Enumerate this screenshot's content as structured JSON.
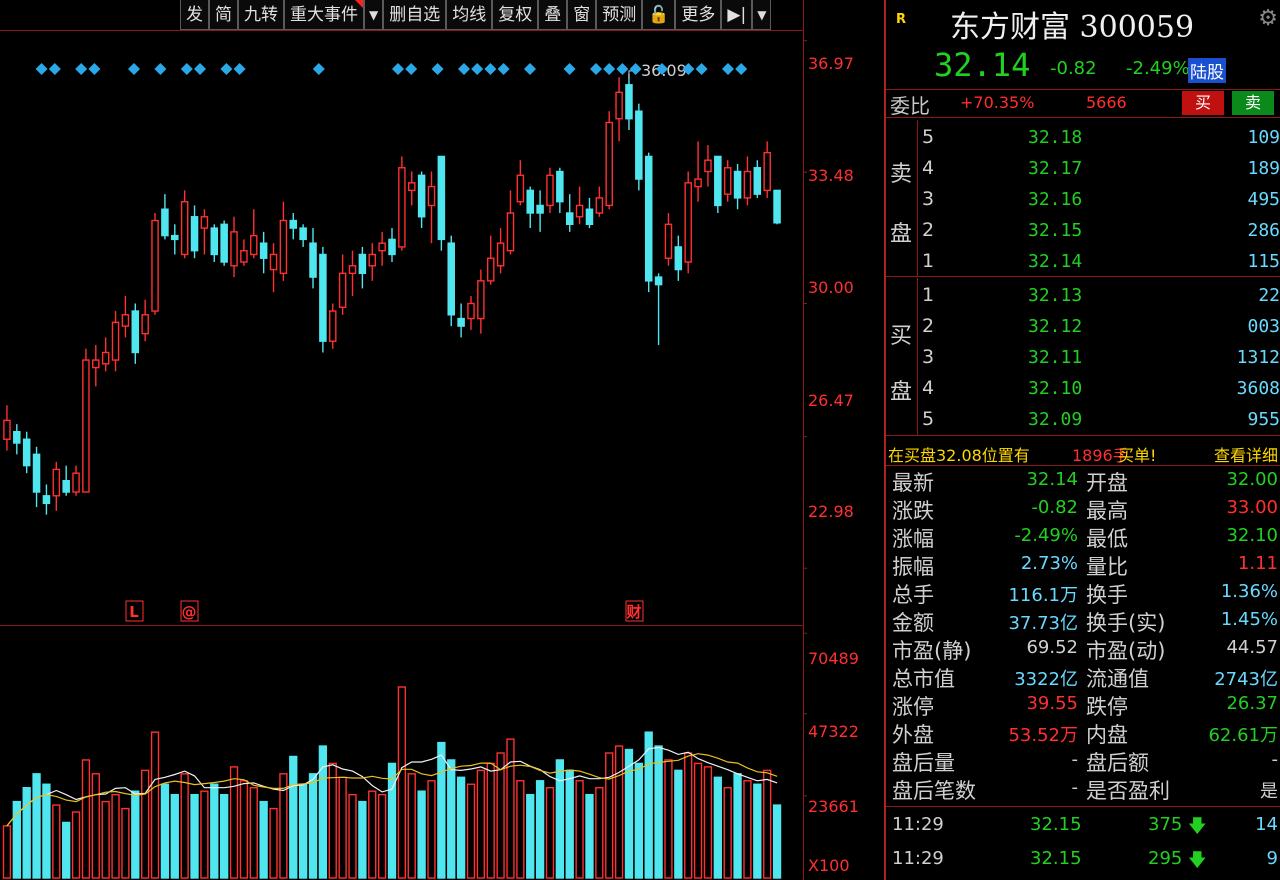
{
  "toolbar": [
    "发",
    "简",
    "九转",
    "重大事件",
    "▼",
    "删自选",
    "均线",
    "复权",
    "叠",
    "窗",
    "预测",
    "🔓",
    "更多",
    "▶|",
    "▼"
  ],
  "header": {
    "badge": "R",
    "title": "东方财富 300059",
    "price": "32.14",
    "change": "-0.82",
    "change_pct": "-2.49%",
    "tag": "陆股"
  },
  "order_ratio": {
    "label": "委比",
    "ratio": "+70.35%",
    "diff": "5666",
    "buy_label": "买",
    "sell_label": "卖"
  },
  "ask_book": {
    "side_labels": [
      "卖",
      "盘"
    ],
    "levels": [
      {
        "n": "5",
        "price": "32.18",
        "vol": "109"
      },
      {
        "n": "4",
        "price": "32.17",
        "vol": "189"
      },
      {
        "n": "3",
        "price": "32.16",
        "vol": "495"
      },
      {
        "n": "2",
        "price": "32.15",
        "vol": "286"
      },
      {
        "n": "1",
        "price": "32.14",
        "vol": "115"
      }
    ]
  },
  "bid_book": {
    "side_labels": [
      "买",
      "盘"
    ],
    "levels": [
      {
        "n": "1",
        "price": "32.13",
        "vol": "22"
      },
      {
        "n": "2",
        "price": "32.12",
        "vol": "003"
      },
      {
        "n": "3",
        "price": "32.11",
        "vol": "1312"
      },
      {
        "n": "4",
        "price": "32.10",
        "vol": "3608"
      },
      {
        "n": "5",
        "price": "32.09",
        "vol": "955"
      }
    ]
  },
  "notice": {
    "text_a": "在买盘32.08位置有",
    "qty": "1896手",
    "text_c": "买单!",
    "link": "查看详细"
  },
  "stats": [
    {
      "l1": "最新",
      "v1": "32.14",
      "c1": "#22d022",
      "l2": "开盘",
      "v2": "32.00",
      "c2": "#22d022"
    },
    {
      "l1": "涨跌",
      "v1": "-0.82",
      "c1": "#22d022",
      "l2": "最高",
      "v2": "33.00",
      "c2": "#ff3030"
    },
    {
      "l1": "涨幅",
      "v1": "-2.49%",
      "c1": "#22d022",
      "l2": "最低",
      "v2": "32.10",
      "c2": "#22d022"
    },
    {
      "l1": "振幅",
      "v1": "2.73%",
      "c1": "#6ad9ff",
      "l2": "量比",
      "v2": "1.11",
      "c2": "#ff3030"
    },
    {
      "l1": "总手",
      "v1": "116.1万",
      "c1": "#6ad9ff",
      "l2": "换手",
      "v2": "1.36%",
      "c2": "#6ad9ff"
    },
    {
      "l1": "金额",
      "v1": "37.73亿",
      "c1": "#6ad9ff",
      "l2": "换手(实)",
      "v2": "1.45%",
      "c2": "#6ad9ff"
    },
    {
      "l1": "市盈(静)",
      "v1": "69.52",
      "c1": "#d0d0d0",
      "l2": "市盈(动)",
      "v2": "44.57",
      "c2": "#d0d0d0"
    },
    {
      "l1": "总市值",
      "v1": "3322亿",
      "c1": "#6ad9ff",
      "l2": "流通值",
      "v2": "2743亿",
      "c2": "#6ad9ff"
    },
    {
      "l1": "涨停",
      "v1": "39.55",
      "c1": "#ff3030",
      "l2": "跌停",
      "v2": "26.37",
      "c2": "#22d022"
    },
    {
      "l1": "外盘",
      "v1": "53.52万",
      "c1": "#ff3030",
      "l2": "内盘",
      "v2": "62.61万",
      "c2": "#22d022"
    },
    {
      "l1": "盘后量",
      "v1": "-",
      "c1": "#d0d0d0",
      "l2": "盘后额",
      "v2": "-",
      "c2": "#d0d0d0"
    },
    {
      "l1": "盘后笔数",
      "v1": "-",
      "c1": "#d0d0d0",
      "l2": "是否盈利",
      "v2": "是",
      "c2": "#d0d0d0"
    }
  ],
  "ticks": [
    {
      "time": "11:29",
      "price": "32.15",
      "vol": "375",
      "count": "14"
    },
    {
      "time": "11:29",
      "price": "32.15",
      "vol": "295",
      "count": "9"
    }
  ],
  "chart_data": {
    "type": "candlestick",
    "price_axis": [
      "36.97",
      "33.48",
      "30.00",
      "26.47",
      "22.98"
    ],
    "ylim": [
      21.5,
      37.2
    ],
    "max_label": "36.09",
    "markers": [
      "L",
      "@",
      "财"
    ],
    "volume_axis": [
      "70489",
      "47322",
      "23661",
      "X100"
    ],
    "volume_ylim": [
      0,
      72000
    ],
    "candles": [
      {
        "o": 26.4,
        "c": 26.9,
        "h": 27.3,
        "l": 26.1
      },
      {
        "o": 26.6,
        "c": 26.3,
        "h": 26.8,
        "l": 26.0
      },
      {
        "o": 26.4,
        "c": 25.7,
        "h": 26.6,
        "l": 25.5
      },
      {
        "o": 26.0,
        "c": 25.0,
        "h": 26.2,
        "l": 24.6
      },
      {
        "o": 24.9,
        "c": 24.7,
        "h": 25.2,
        "l": 24.4
      },
      {
        "o": 24.9,
        "c": 25.6,
        "h": 25.8,
        "l": 24.5
      },
      {
        "o": 25.3,
        "c": 25.0,
        "h": 25.7,
        "l": 24.9
      },
      {
        "o": 25.0,
        "c": 25.5,
        "h": 25.7,
        "l": 24.9
      },
      {
        "o": 25.0,
        "c": 28.5,
        "h": 28.8,
        "l": 25.0
      },
      {
        "o": 28.3,
        "c": 28.5,
        "h": 28.9,
        "l": 27.8
      },
      {
        "o": 28.4,
        "c": 28.7,
        "h": 29.1,
        "l": 28.2
      },
      {
        "o": 28.5,
        "c": 29.5,
        "h": 29.8,
        "l": 28.2
      },
      {
        "o": 29.4,
        "c": 29.7,
        "h": 30.2,
        "l": 29.1
      },
      {
        "o": 29.8,
        "c": 28.7,
        "h": 30.0,
        "l": 28.4
      },
      {
        "o": 29.2,
        "c": 29.7,
        "h": 30.1,
        "l": 29.0
      },
      {
        "o": 29.8,
        "c": 32.2,
        "h": 32.4,
        "l": 29.7
      },
      {
        "o": 32.5,
        "c": 31.8,
        "h": 32.9,
        "l": 31.7
      },
      {
        "o": 31.8,
        "c": 31.7,
        "h": 32.1,
        "l": 31.3
      },
      {
        "o": 31.3,
        "c": 32.7,
        "h": 33.0,
        "l": 31.2
      },
      {
        "o": 32.3,
        "c": 31.4,
        "h": 32.6,
        "l": 31.2
      },
      {
        "o": 32.0,
        "c": 32.3,
        "h": 32.5,
        "l": 31.3
      },
      {
        "o": 32.0,
        "c": 31.3,
        "h": 32.1,
        "l": 31.1
      },
      {
        "o": 32.1,
        "c": 31.1,
        "h": 32.2,
        "l": 31.0
      },
      {
        "o": 31.0,
        "c": 31.9,
        "h": 32.3,
        "l": 30.7
      },
      {
        "o": 31.1,
        "c": 31.4,
        "h": 31.7,
        "l": 31.0
      },
      {
        "o": 31.3,
        "c": 31.8,
        "h": 32.5,
        "l": 31.2
      },
      {
        "o": 31.6,
        "c": 31.2,
        "h": 31.9,
        "l": 30.8
      },
      {
        "o": 30.9,
        "c": 31.3,
        "h": 31.6,
        "l": 30.3
      },
      {
        "o": 30.8,
        "c": 32.2,
        "h": 32.7,
        "l": 30.6
      },
      {
        "o": 32.2,
        "c": 32.0,
        "h": 32.4,
        "l": 31.7
      },
      {
        "o": 32.0,
        "c": 31.7,
        "h": 32.1,
        "l": 31.5
      },
      {
        "o": 31.6,
        "c": 30.7,
        "h": 32.0,
        "l": 30.4
      },
      {
        "o": 31.3,
        "c": 29.0,
        "h": 31.5,
        "l": 28.7
      },
      {
        "o": 29.0,
        "c": 29.8,
        "h": 30.0,
        "l": 28.8
      },
      {
        "o": 29.9,
        "c": 30.8,
        "h": 31.3,
        "l": 29.7
      },
      {
        "o": 30.8,
        "c": 31.0,
        "h": 31.4,
        "l": 30.2
      },
      {
        "o": 31.3,
        "c": 30.8,
        "h": 31.5,
        "l": 30.4
      },
      {
        "o": 31.0,
        "c": 31.3,
        "h": 31.6,
        "l": 30.6
      },
      {
        "o": 31.4,
        "c": 31.6,
        "h": 31.9,
        "l": 31.0
      },
      {
        "o": 31.7,
        "c": 31.3,
        "h": 32.0,
        "l": 31.1
      },
      {
        "o": 31.5,
        "c": 33.6,
        "h": 33.9,
        "l": 31.4
      },
      {
        "o": 33.0,
        "c": 33.2,
        "h": 33.5,
        "l": 32.6
      },
      {
        "o": 33.4,
        "c": 32.3,
        "h": 33.5,
        "l": 32.0
      },
      {
        "o": 32.6,
        "c": 33.1,
        "h": 33.5,
        "l": 31.6
      },
      {
        "o": 33.9,
        "c": 31.7,
        "h": 33.9,
        "l": 31.4
      },
      {
        "o": 31.6,
        "c": 29.7,
        "h": 31.8,
        "l": 29.4
      },
      {
        "o": 29.6,
        "c": 29.4,
        "h": 30.0,
        "l": 29.1
      },
      {
        "o": 29.6,
        "c": 30.0,
        "h": 30.2,
        "l": 29.3
      },
      {
        "o": 29.6,
        "c": 30.6,
        "h": 30.9,
        "l": 29.2
      },
      {
        "o": 30.6,
        "c": 31.2,
        "h": 31.8,
        "l": 30.5
      },
      {
        "o": 31.0,
        "c": 31.6,
        "h": 32.0,
        "l": 30.8
      },
      {
        "o": 31.4,
        "c": 32.4,
        "h": 33.0,
        "l": 31.3
      },
      {
        "o": 32.7,
        "c": 33.4,
        "h": 33.8,
        "l": 32.6
      },
      {
        "o": 33.0,
        "c": 32.4,
        "h": 33.1,
        "l": 32.0
      },
      {
        "o": 32.6,
        "c": 32.4,
        "h": 33.0,
        "l": 31.9
      },
      {
        "o": 32.6,
        "c": 33.4,
        "h": 33.6,
        "l": 32.4
      },
      {
        "o": 33.5,
        "c": 32.7,
        "h": 33.6,
        "l": 32.4
      },
      {
        "o": 32.4,
        "c": 32.1,
        "h": 32.9,
        "l": 31.9
      },
      {
        "o": 32.3,
        "c": 32.6,
        "h": 33.1,
        "l": 32.1
      },
      {
        "o": 32.5,
        "c": 32.1,
        "h": 32.8,
        "l": 32.0
      },
      {
        "o": 32.4,
        "c": 32.8,
        "h": 33.1,
        "l": 32.3
      },
      {
        "o": 32.6,
        "c": 34.8,
        "h": 35.1,
        "l": 32.5
      },
      {
        "o": 34.9,
        "c": 35.6,
        "h": 36.0,
        "l": 34.3
      },
      {
        "o": 35.8,
        "c": 34.9,
        "h": 36.09,
        "l": 34.6
      },
      {
        "o": 35.1,
        "c": 33.3,
        "h": 35.3,
        "l": 33.0
      },
      {
        "o": 33.9,
        "c": 30.6,
        "h": 34.0,
        "l": 30.3
      },
      {
        "o": 30.7,
        "c": 30.5,
        "h": 30.8,
        "l": 28.9
      },
      {
        "o": 31.2,
        "c": 32.1,
        "h": 32.4,
        "l": 31.0
      },
      {
        "o": 31.5,
        "c": 30.9,
        "h": 31.8,
        "l": 30.6
      },
      {
        "o": 31.1,
        "c": 33.2,
        "h": 33.5,
        "l": 30.8
      },
      {
        "o": 33.1,
        "c": 33.3,
        "h": 34.3,
        "l": 32.7
      },
      {
        "o": 33.5,
        "c": 33.8,
        "h": 34.2,
        "l": 33.1
      },
      {
        "o": 33.9,
        "c": 32.6,
        "h": 33.9,
        "l": 32.4
      },
      {
        "o": 32.9,
        "c": 33.6,
        "h": 33.8,
        "l": 32.7
      },
      {
        "o": 33.5,
        "c": 32.8,
        "h": 33.7,
        "l": 32.5
      },
      {
        "o": 32.8,
        "c": 33.5,
        "h": 33.9,
        "l": 32.6
      },
      {
        "o": 33.6,
        "c": 32.9,
        "h": 33.8,
        "l": 32.8
      },
      {
        "o": 33.0,
        "c": 34.0,
        "h": 34.3,
        "l": 32.8
      },
      {
        "o": 33.0,
        "c": 32.14,
        "h": 33.0,
        "l": 32.1
      }
    ],
    "volumes": [
      15000,
      22000,
      26000,
      30000,
      27000,
      21000,
      16000,
      19000,
      34000,
      30000,
      22000,
      24000,
      20000,
      25000,
      31000,
      42000,
      27000,
      24000,
      30000,
      24000,
      25000,
      27000,
      24000,
      32000,
      28000,
      26000,
      22000,
      20000,
      30000,
      35000,
      27000,
      30000,
      38000,
      33000,
      29000,
      24000,
      22000,
      25000,
      24000,
      33000,
      55000,
      30000,
      25000,
      28000,
      39000,
      34000,
      29000,
      27000,
      31000,
      33000,
      36000,
      40000,
      28000,
      24000,
      28000,
      26000,
      34000,
      31000,
      28000,
      24000,
      26000,
      36000,
      38000,
      37000,
      33000,
      42000,
      38000,
      34000,
      31000,
      36000,
      33000,
      32000,
      29000,
      26000,
      30000,
      28000,
      27000,
      31000,
      21000
    ],
    "diamond_days": [
      3,
      4,
      6,
      7,
      10,
      12,
      14,
      15,
      17,
      18,
      24,
      30,
      31,
      33,
      35,
      36,
      37,
      38,
      40,
      43,
      45,
      46,
      47,
      48,
      50,
      52,
      53,
      55,
      56
    ]
  }
}
